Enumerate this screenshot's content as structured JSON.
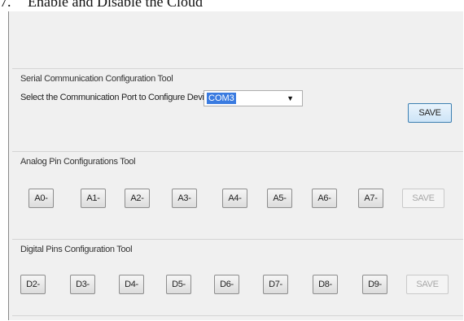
{
  "document": {
    "heading_number": "7.",
    "heading_text": "Enable and Disable the Cloud"
  },
  "serial_group": {
    "title": "Serial Communication Configuration Tool",
    "port_label": "Select the Communication Port to Configure Device :",
    "port_value": "COM3",
    "save_label": "SAVE"
  },
  "analog_group": {
    "title": "Analog Pin Configurations Tool",
    "pins": [
      "A0-",
      "A1-",
      "A2-",
      "A3-",
      "A4-",
      "A5-",
      "A6-",
      "A7-"
    ],
    "save_label": "SAVE"
  },
  "digital_group": {
    "title": "Digital Pins Configuration Tool",
    "pins": [
      "D2-",
      "D3-",
      "D4-",
      "D5-",
      "D6-",
      "D7-",
      "D8-",
      "D9-"
    ],
    "save_label": "SAVE"
  },
  "colors": {
    "accent": "#3a7be0",
    "window_bg": "#f0f0f0"
  },
  "icons": {
    "dropdown": "caret-down-icon"
  }
}
